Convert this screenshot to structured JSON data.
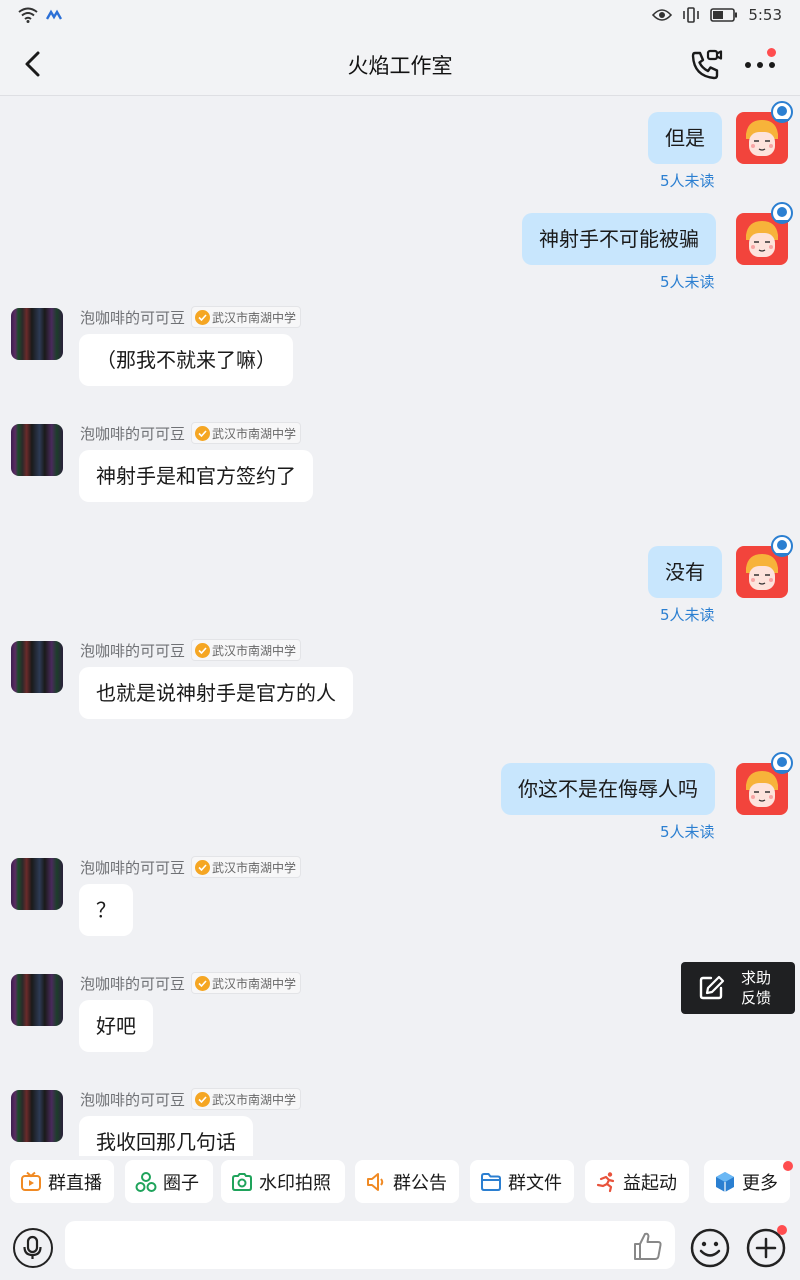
{
  "status": {
    "time": "5:53"
  },
  "header": {
    "title": "火焰工作室"
  },
  "messages": [
    {
      "from": "me",
      "text": "但是",
      "status": "5人未读"
    },
    {
      "from": "me",
      "text": "神射手不可能被骗",
      "status": "5人未读"
    },
    {
      "from": "them",
      "sender": "泡咖啡的可可豆",
      "badge": "武汉市南湖中学",
      "text": "（那我不就来了嘛）"
    },
    {
      "from": "them",
      "sender": "泡咖啡的可可豆",
      "badge": "武汉市南湖中学",
      "text": "神射手是和官方签约了"
    },
    {
      "from": "me",
      "text": "没有",
      "status": "5人未读"
    },
    {
      "from": "them",
      "sender": "泡咖啡的可可豆",
      "badge": "武汉市南湖中学",
      "text": "也就是说神射手是官方的人"
    },
    {
      "from": "me",
      "text": "你这不是在侮辱人吗",
      "status": "5人未读"
    },
    {
      "from": "them",
      "sender": "泡咖啡的可可豆",
      "badge": "武汉市南湖中学",
      "text": "？"
    },
    {
      "from": "them",
      "sender": "泡咖啡的可可豆",
      "badge": "武汉市南湖中学",
      "text": "好吧"
    },
    {
      "from": "them",
      "sender": "泡咖啡的可可豆",
      "badge": "武汉市南湖中学",
      "text": "我收回那几句话"
    }
  ],
  "help_float": {
    "line1": "求助",
    "line2": "反馈"
  },
  "quick_actions": [
    {
      "label": "群直播",
      "icon": "live-tv-icon"
    },
    {
      "label": "圈子",
      "icon": "circle-icon"
    },
    {
      "label": "水印拍照",
      "icon": "camera-icon"
    },
    {
      "label": "群公告",
      "icon": "speaker-icon"
    },
    {
      "label": "群文件",
      "icon": "folder-icon"
    },
    {
      "label": "益起动",
      "icon": "runner-icon"
    },
    {
      "label": "更多",
      "icon": "cube-icon"
    }
  ],
  "input": {
    "placeholder": ""
  },
  "colors": {
    "my_bubble": "#c8e6fd",
    "their_bubble": "#ffffff",
    "unread_text": "#2b7fd1",
    "badge_dot": "#ff4d4f"
  }
}
